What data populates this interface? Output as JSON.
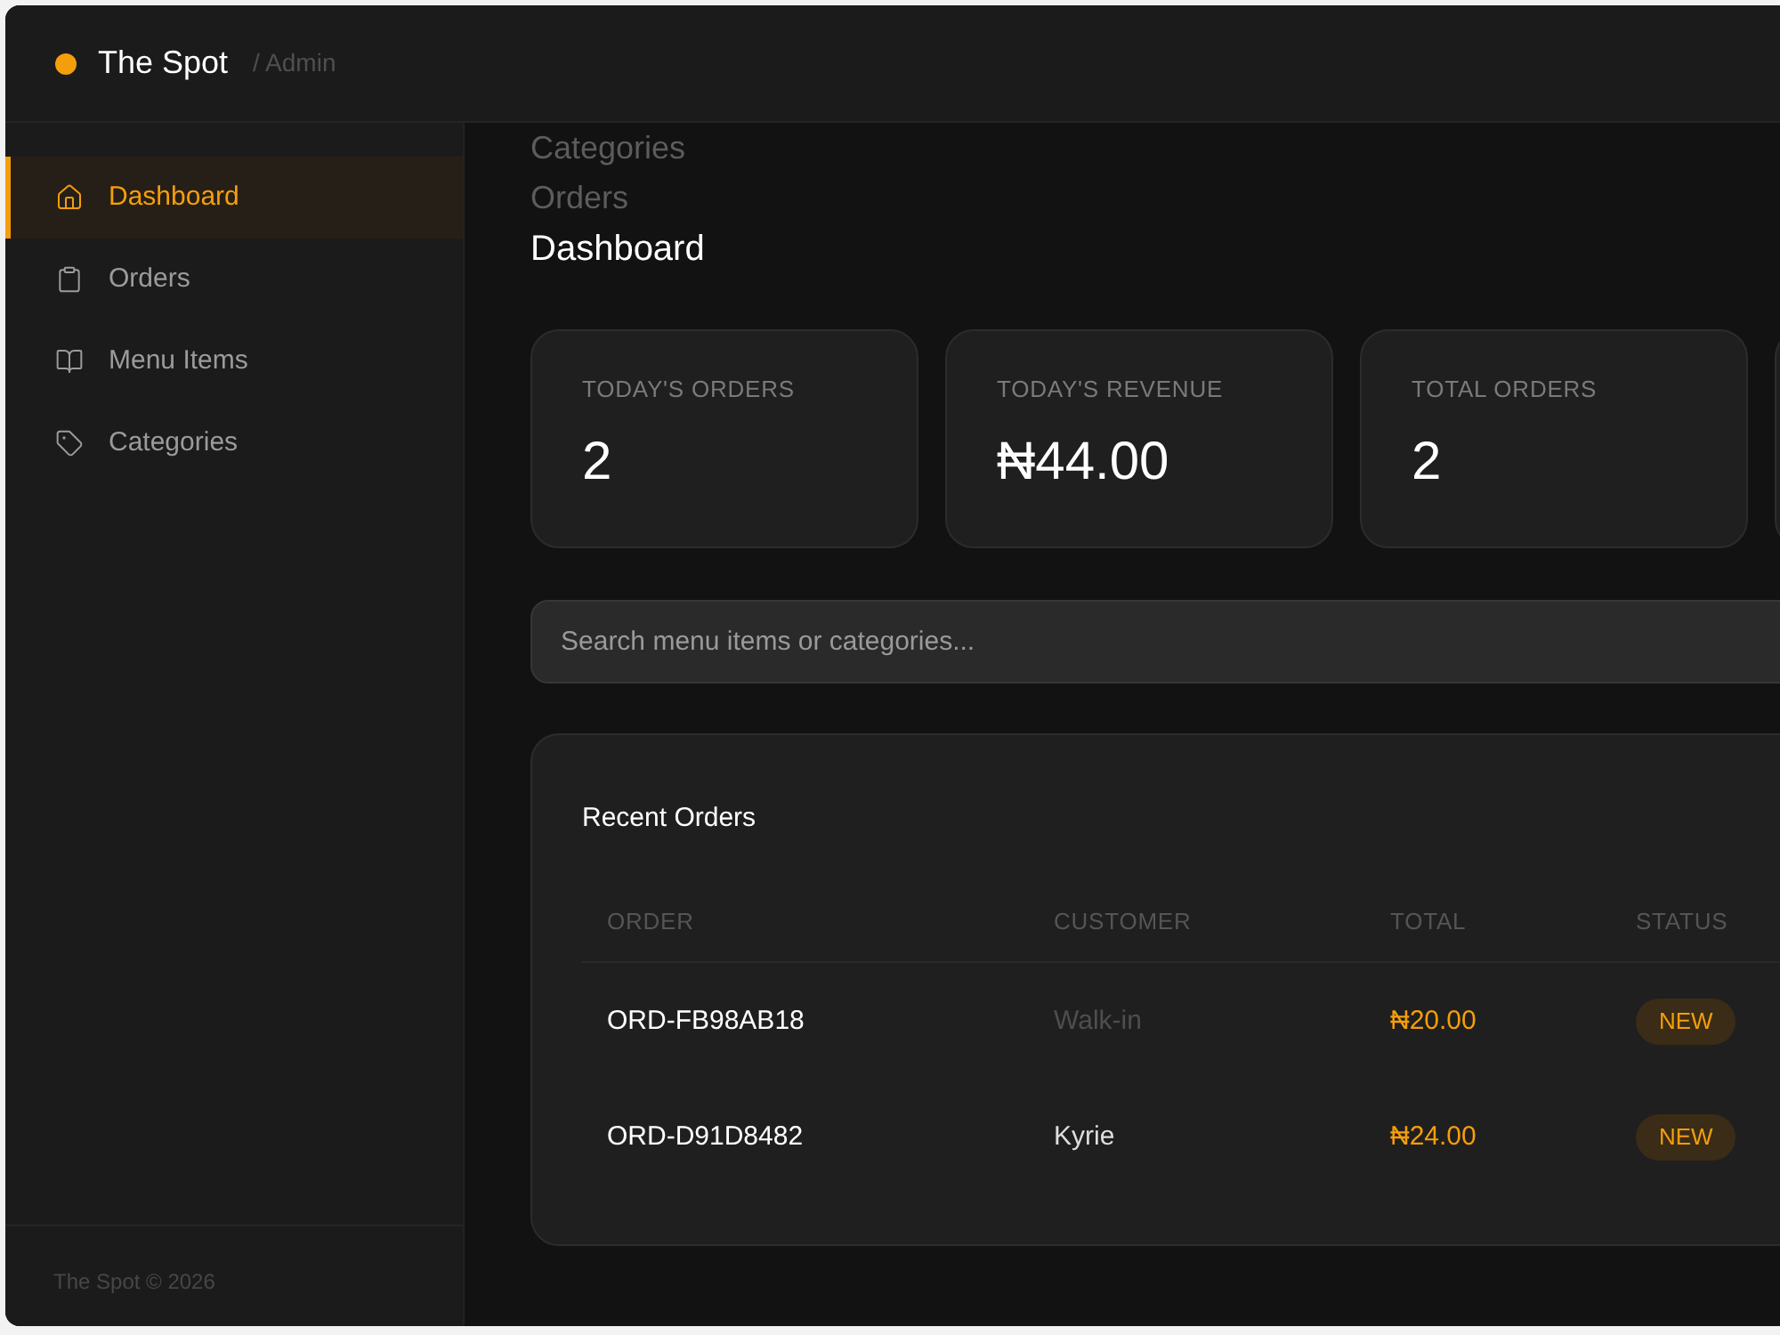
{
  "header": {
    "brand": "The Spot",
    "section": "/ Admin"
  },
  "sidebar": {
    "items": [
      {
        "label": "Dashboard",
        "selected": true
      },
      {
        "label": "Orders",
        "selected": false
      },
      {
        "label": "Menu Items",
        "selected": false
      },
      {
        "label": "Categories",
        "selected": false
      }
    ],
    "footer": "The Spot © 2026"
  },
  "page_titles": [
    {
      "label": "Categories",
      "selected": false
    },
    {
      "label": "Orders",
      "selected": false
    },
    {
      "label": "Dashboard",
      "selected": true
    }
  ],
  "stat_cards": [
    {
      "label": "TODAY'S ORDERS",
      "value": "2"
    },
    {
      "label": "TODAY'S REVENUE",
      "value": "₦44.00"
    },
    {
      "label": "TOTAL ORDERS",
      "value": "2"
    }
  ],
  "search": {
    "placeholder": "Search menu items or categories..."
  },
  "recent_orders": {
    "title": "Recent Orders",
    "columns": [
      "ORDER",
      "CUSTOMER",
      "TOTAL",
      "STATUS"
    ],
    "rows": [
      {
        "order": "ORD-FB98AB18",
        "customer": "Walk-in",
        "customer_dimmed": true,
        "total": "₦20.00",
        "status": "NEW"
      },
      {
        "order": "ORD-D91D8482",
        "customer": "Kyrie",
        "customer_dimmed": false,
        "total": "₦24.00",
        "status": "NEW"
      }
    ]
  }
}
